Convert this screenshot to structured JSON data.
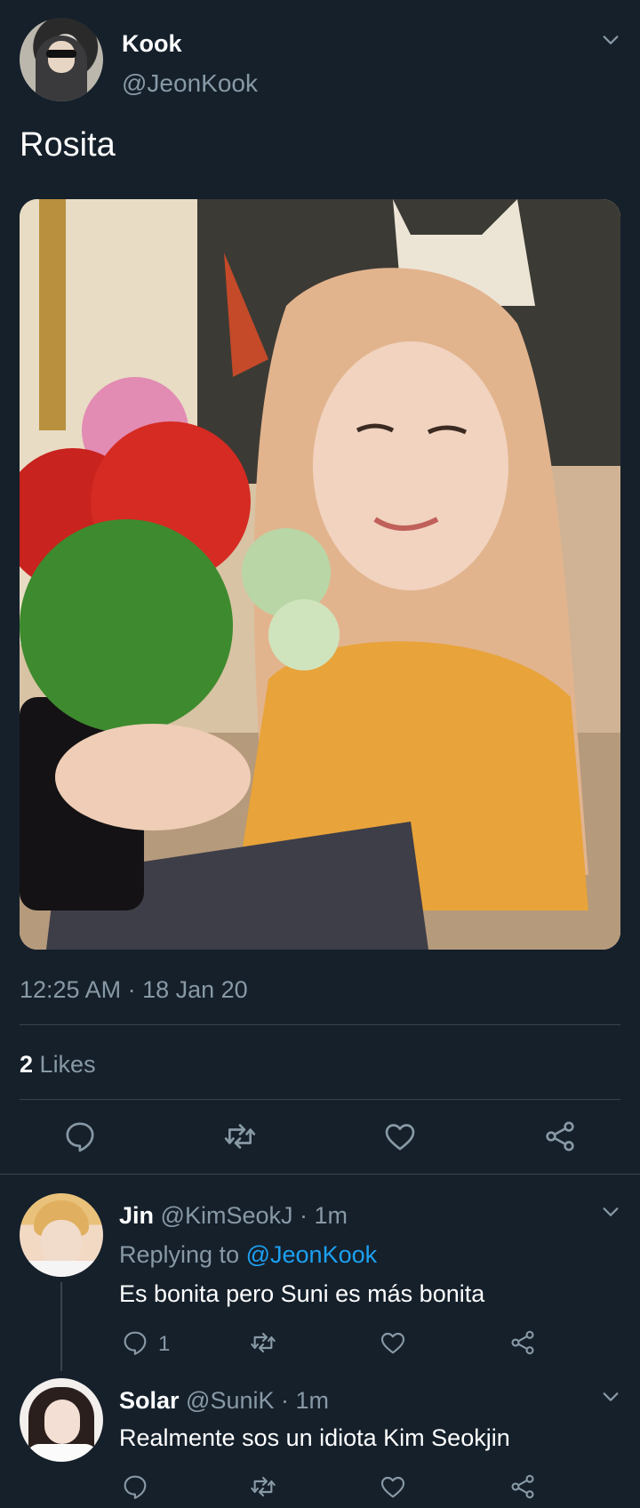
{
  "tweet": {
    "author_name": "Kook",
    "author_handle": "@JeonKook",
    "text": "Rosita",
    "timestamp": "12:25 AM · 18 Jan 20",
    "likes_count": "2",
    "likes_label": "Likes"
  },
  "replies": [
    {
      "name": "Jin",
      "handle": "@KimSeokJ",
      "time": "· 1m",
      "replying_prefix": "Replying to",
      "replying_to": "@JeonKook",
      "text": "Es bonita pero Suni es más bonita",
      "reply_count": "1"
    },
    {
      "name": "Solar",
      "handle": "@SuniK",
      "time": "· 1m",
      "text": "Realmente sos un idiota Kim Seokjin"
    }
  ],
  "colors": {
    "background": "#15202b",
    "secondary_text": "#8899a6",
    "link": "#1da1f2",
    "divider": "#38444d"
  },
  "icons": [
    "reply-icon",
    "retweet-icon",
    "like-icon",
    "share-icon",
    "chevron-down-icon"
  ]
}
